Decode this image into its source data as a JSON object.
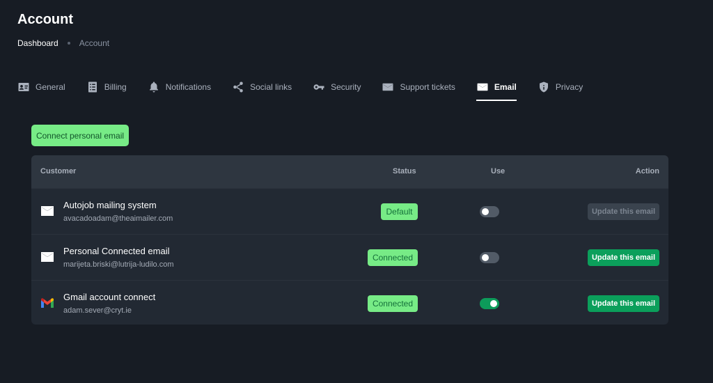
{
  "page": {
    "title": "Account"
  },
  "breadcrumb": {
    "items": [
      "Dashboard",
      "Account"
    ]
  },
  "tabs": [
    {
      "label": "General",
      "icon": "id-card-icon"
    },
    {
      "label": "Billing",
      "icon": "receipt-icon"
    },
    {
      "label": "Notifications",
      "icon": "bell-icon"
    },
    {
      "label": "Social links",
      "icon": "share-icon"
    },
    {
      "label": "Security",
      "icon": "key-icon"
    },
    {
      "label": "Support tickets",
      "icon": "envelope-icon"
    },
    {
      "label": "Email",
      "icon": "envelope-icon",
      "active": true
    },
    {
      "label": "Privacy",
      "icon": "shield-icon"
    }
  ],
  "connect_button": {
    "label": "Connect personal email"
  },
  "table": {
    "headers": {
      "customer": "Customer",
      "status": "Status",
      "use": "Use",
      "action": "Action"
    },
    "rows": [
      {
        "icon": "envelope-icon",
        "title": "Autojob mailing system",
        "email": "avacadoadam@theaimailer.com",
        "status": "Default",
        "use": false,
        "action": "Update this email",
        "action_enabled": false
      },
      {
        "icon": "envelope-icon",
        "title": "Personal Connected email",
        "email": "marijeta.briski@lutrija-ludilo.com",
        "status": "Connected",
        "use": false,
        "action": "Update this email",
        "action_enabled": true
      },
      {
        "icon": "gmail-icon",
        "title": "Gmail account connect",
        "email": "adam.sever@cryt.ie",
        "status": "Connected",
        "use": true,
        "action": "Update this email",
        "action_enabled": true
      }
    ]
  },
  "colors": {
    "background": "#171c24",
    "card": "#222933",
    "header_row": "#2e3640",
    "badge_green": "#77eb86",
    "action_green": "#0b9f5b",
    "toggle_on": "#0d9b5a",
    "toggle_off": "#525b67"
  }
}
